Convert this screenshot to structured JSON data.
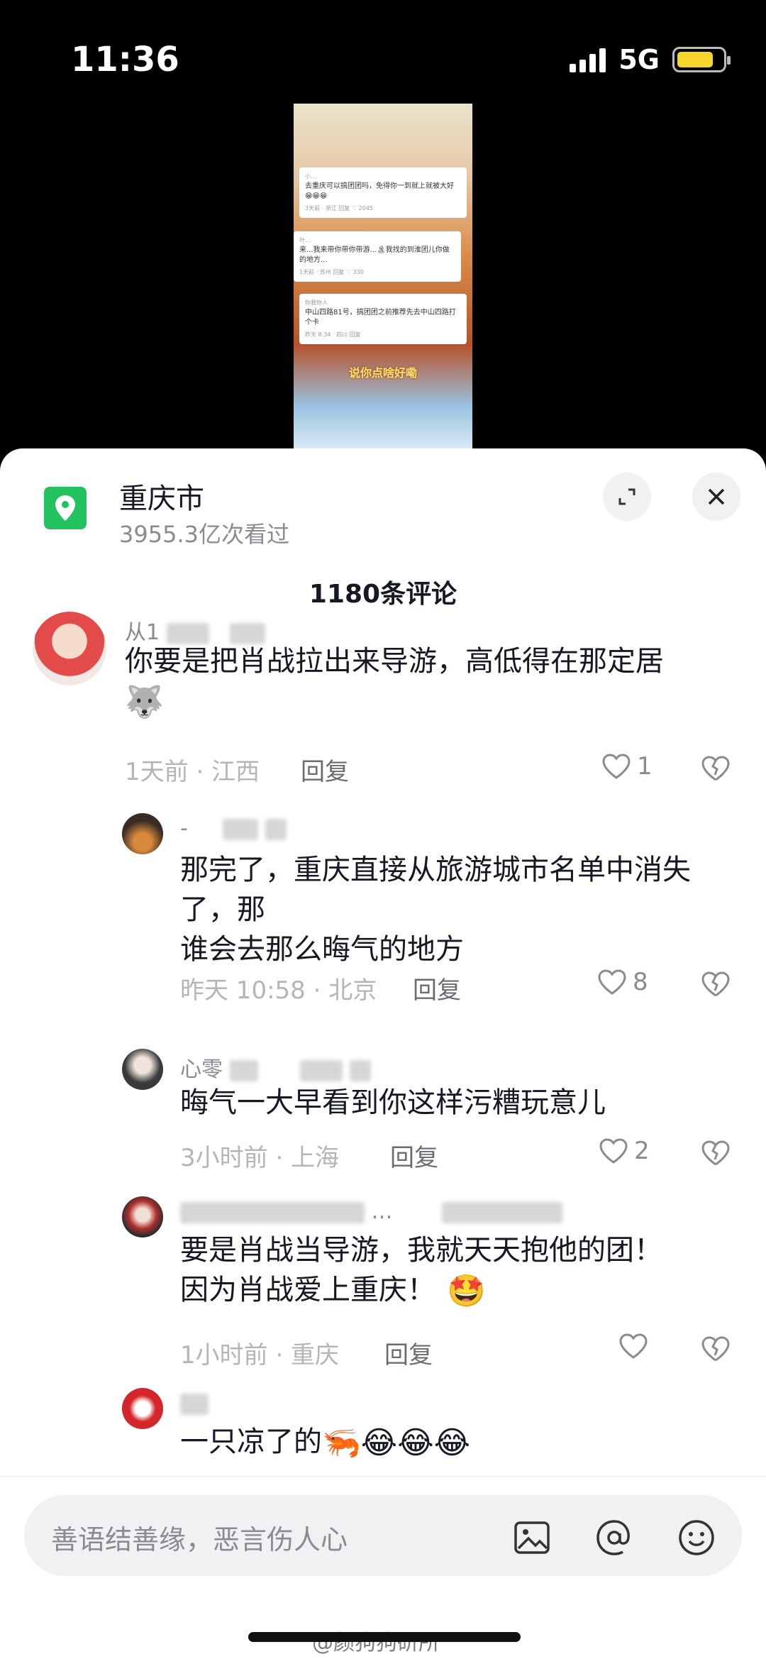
{
  "status_bar": {
    "time": "11:36",
    "network": "5G"
  },
  "video": {
    "cards": [
      {
        "user": "小...",
        "text": "去重庆可以搞团团吗，免得你一到就上就被大好😁😁😁",
        "meta": "3天前 · 浙江   回复   ♡ 2045"
      },
      {
        "user": "叶...",
        "text": "来...我来带你带你带游...🏝我找的到淮团儿你做的地方...",
        "meta": "1天前 · 苏州   回复   ♡ 330"
      },
      {
        "user": "你我你人",
        "text": "中山四路81号，搞团团之前推荐先去中山四路打个卡",
        "meta": "昨天 8:34 · 四川   回复"
      }
    ],
    "caption": "说你点啥好嘞"
  },
  "header": {
    "title": "重庆市",
    "views": "3955.3亿次看过"
  },
  "comment_count": "1180条评论",
  "comments": [
    {
      "user": "从1",
      "text": "你要是把肖战拉出来导游，高低得在那定居",
      "emoji": "🐺",
      "meta": "1天前 · 江西",
      "reply": "回复",
      "likes": "1"
    },
    {
      "user": "-",
      "text": "那完了，重庆直接从旅游城市名单中消失了，那\n谁会去那么晦气的地方",
      "meta": "昨天 10:58 · 北京",
      "reply": "回复",
      "likes": "8"
    },
    {
      "user": "心零",
      "text": "晦气一大早看到你这样污糟玩意儿",
      "meta": "3小时前 · 上海",
      "reply": "回复",
      "likes": "2"
    },
    {
      "user": "…",
      "text": "要是肖战当导游，我就天天抱他的团！\n因为肖战爱上重庆！",
      "emoji": "🤩",
      "meta": "1小时前 · 重庆",
      "reply": "回复",
      "likes": ""
    },
    {
      "user": "",
      "text": "一只凉了的",
      "emoji": "🦐😂😂😂"
    }
  ],
  "input": {
    "placeholder": "善语结善缘，恶言伤人心"
  },
  "watermark": "@颜狗狗研所"
}
